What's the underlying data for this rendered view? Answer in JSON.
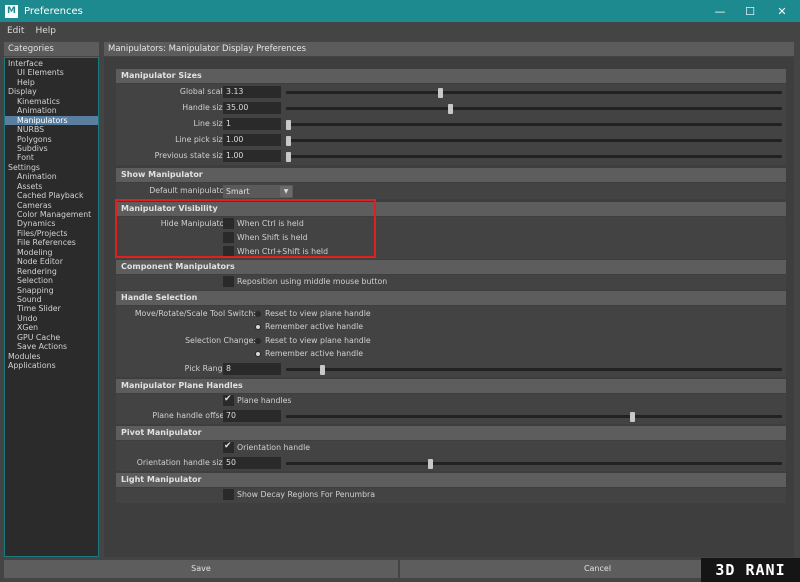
{
  "window": {
    "title": "Preferences",
    "logo_letter": "M",
    "controls": {
      "minimize": "—",
      "maximize": "☐",
      "close": "✕"
    }
  },
  "menu": [
    "Edit",
    "Help"
  ],
  "categories": {
    "header": "Categories",
    "items": [
      {
        "label": "Interface",
        "level": 1
      },
      {
        "label": "UI Elements",
        "level": 2
      },
      {
        "label": "Help",
        "level": 2
      },
      {
        "label": "Display",
        "level": 1
      },
      {
        "label": "Kinematics",
        "level": 2
      },
      {
        "label": "Animation",
        "level": 2
      },
      {
        "label": "Manipulators",
        "level": 2,
        "selected": true
      },
      {
        "label": "NURBS",
        "level": 2
      },
      {
        "label": "Polygons",
        "level": 2
      },
      {
        "label": "Subdivs",
        "level": 2
      },
      {
        "label": "Font",
        "level": 2
      },
      {
        "label": "Settings",
        "level": 1
      },
      {
        "label": "Animation",
        "level": 2
      },
      {
        "label": "Assets",
        "level": 2
      },
      {
        "label": "Cached Playback",
        "level": 2
      },
      {
        "label": "Cameras",
        "level": 2
      },
      {
        "label": "Color Management",
        "level": 2
      },
      {
        "label": "Dynamics",
        "level": 2
      },
      {
        "label": "Files/Projects",
        "level": 2
      },
      {
        "label": "File References",
        "level": 2
      },
      {
        "label": "Modeling",
        "level": 2
      },
      {
        "label": "Node Editor",
        "level": 2
      },
      {
        "label": "Rendering",
        "level": 2
      },
      {
        "label": "Selection",
        "level": 2
      },
      {
        "label": "Snapping",
        "level": 2
      },
      {
        "label": "Sound",
        "level": 2
      },
      {
        "label": "Time Slider",
        "level": 2
      },
      {
        "label": "Undo",
        "level": 2
      },
      {
        "label": "XGen",
        "level": 2
      },
      {
        "label": "GPU Cache",
        "level": 2
      },
      {
        "label": "Save Actions",
        "level": 2
      },
      {
        "label": "Modules",
        "level": 1
      },
      {
        "label": "Applications",
        "level": 1
      }
    ]
  },
  "panel_title": "Manipulators: Manipulator Display Preferences",
  "sections": {
    "sizes": {
      "title": "Manipulator Sizes",
      "rows": [
        {
          "label": "Global scale:",
          "value": "3.13",
          "slider": 0.31
        },
        {
          "label": "Handle size:",
          "value": "35.00",
          "slider": 0.33
        },
        {
          "label": "Line size:",
          "value": "1",
          "slider": 0.0
        },
        {
          "label": "Line pick size:",
          "value": "1.00",
          "slider": 0.0
        },
        {
          "label": "Previous state size:",
          "value": "1.00",
          "slider": 0.0
        }
      ]
    },
    "show": {
      "title": "Show Manipulator",
      "default_label": "Default manipulator:",
      "default_value": "Smart",
      "arrow": "▼"
    },
    "visibility": {
      "title": "Manipulator Visibility",
      "hide_label": "Hide Manipulator:",
      "options": [
        {
          "label": "When Ctrl is held",
          "checked": false
        },
        {
          "label": "When Shift is held",
          "checked": false
        },
        {
          "label": "When Ctrl+Shift is held",
          "checked": false
        }
      ]
    },
    "component": {
      "title": "Component Manipulators",
      "option": {
        "label": "Reposition using middle mouse button",
        "checked": false
      }
    },
    "handle_selection": {
      "title": "Handle Selection",
      "switch_label": "Move/Rotate/Scale Tool Switch:",
      "switch_options": [
        {
          "label": "Reset to view plane handle",
          "selected": false
        },
        {
          "label": "Remember active handle",
          "selected": true
        }
      ],
      "change_label": "Selection Change:",
      "change_options": [
        {
          "label": "Reset to view plane handle",
          "selected": false
        },
        {
          "label": "Remember active handle",
          "selected": true
        }
      ],
      "pick_label": "Pick Range:",
      "pick_value": "8",
      "pick_slider": 0.07
    },
    "plane": {
      "title": "Manipulator Plane Handles",
      "option": {
        "label": "Plane handles",
        "checked": true
      },
      "offset_label": "Plane handle offset:",
      "offset_value": "70",
      "offset_slider": 0.7
    },
    "pivot": {
      "title": "Pivot Manipulator",
      "option": {
        "label": "Orientation handle",
        "checked": true
      },
      "size_label": "Orientation handle size:",
      "size_value": "50",
      "size_slider": 0.29
    },
    "light": {
      "title": "Light Manipulator",
      "option": {
        "label": "Show Decay Regions For Penumbra",
        "checked": false
      }
    }
  },
  "buttons": {
    "save": "Save",
    "cancel": "Cancel"
  },
  "watermark": "3D RANI",
  "colors": {
    "title_bar": "#1d8a90",
    "highlight": "#e01f1f",
    "selected": "#5a7f9e"
  }
}
